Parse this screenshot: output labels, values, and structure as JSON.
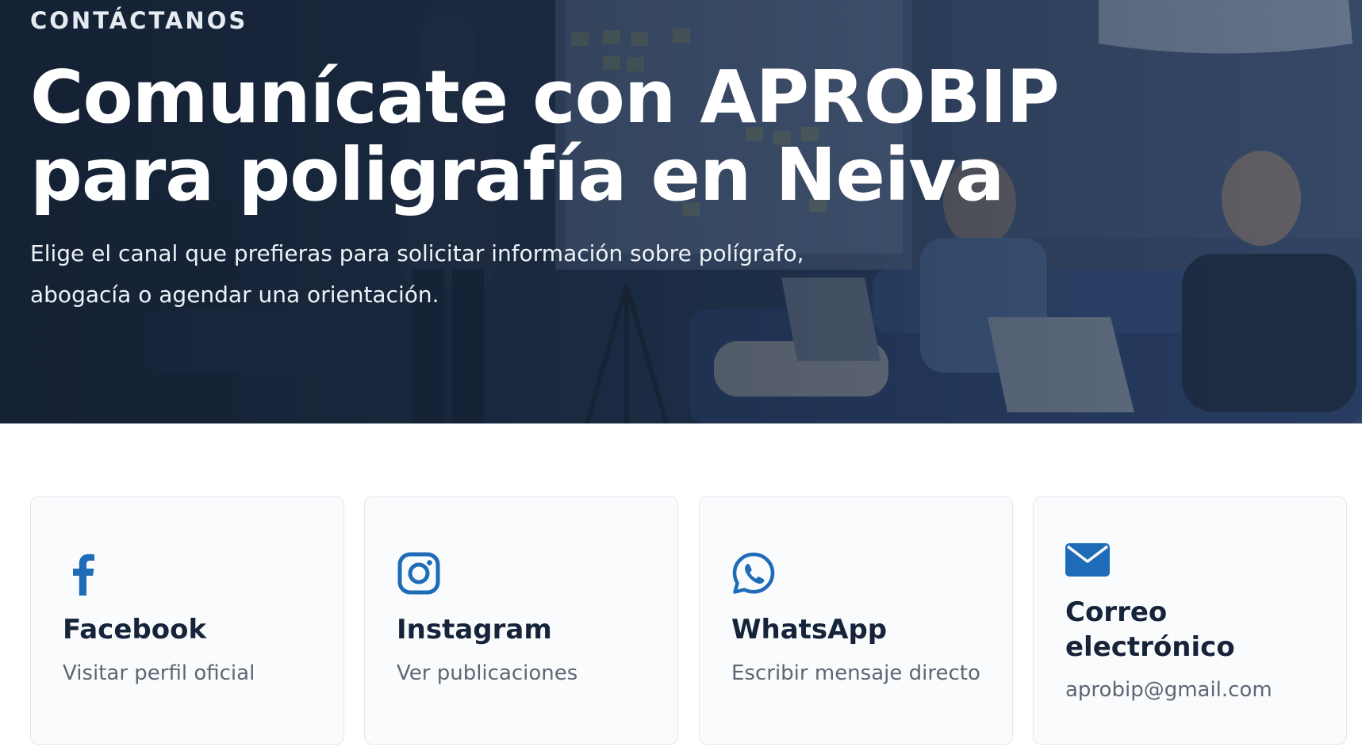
{
  "hero": {
    "eyebrow": "CONTÁCTANOS",
    "title_line1": "Comunícate con APROBIP",
    "title_line2": "para poligrafía en Neiva",
    "subtitle_line1": "Elige el canal que prefieras para solicitar información sobre polígrafo,",
    "subtitle_line2": "abogacía o agendar una orientación."
  },
  "cards": [
    {
      "title": "Facebook",
      "description": "Visitar perfil oficial",
      "icon": "facebook-icon"
    },
    {
      "title": "Instagram",
      "description": "Ver publicaciones",
      "icon": "instagram-icon"
    },
    {
      "title": "WhatsApp",
      "description": "Escribir mensaje directo",
      "icon": "whatsapp-icon"
    },
    {
      "title_line1": "Correo",
      "title_line2": "electrónico",
      "description": "aprobip@gmail.com",
      "icon": "envelope-icon"
    }
  ],
  "colors": {
    "accent": "#1e6bb8",
    "heading": "#16243a",
    "muted": "#5d6673",
    "hero_dark": "#1b2a3f"
  }
}
